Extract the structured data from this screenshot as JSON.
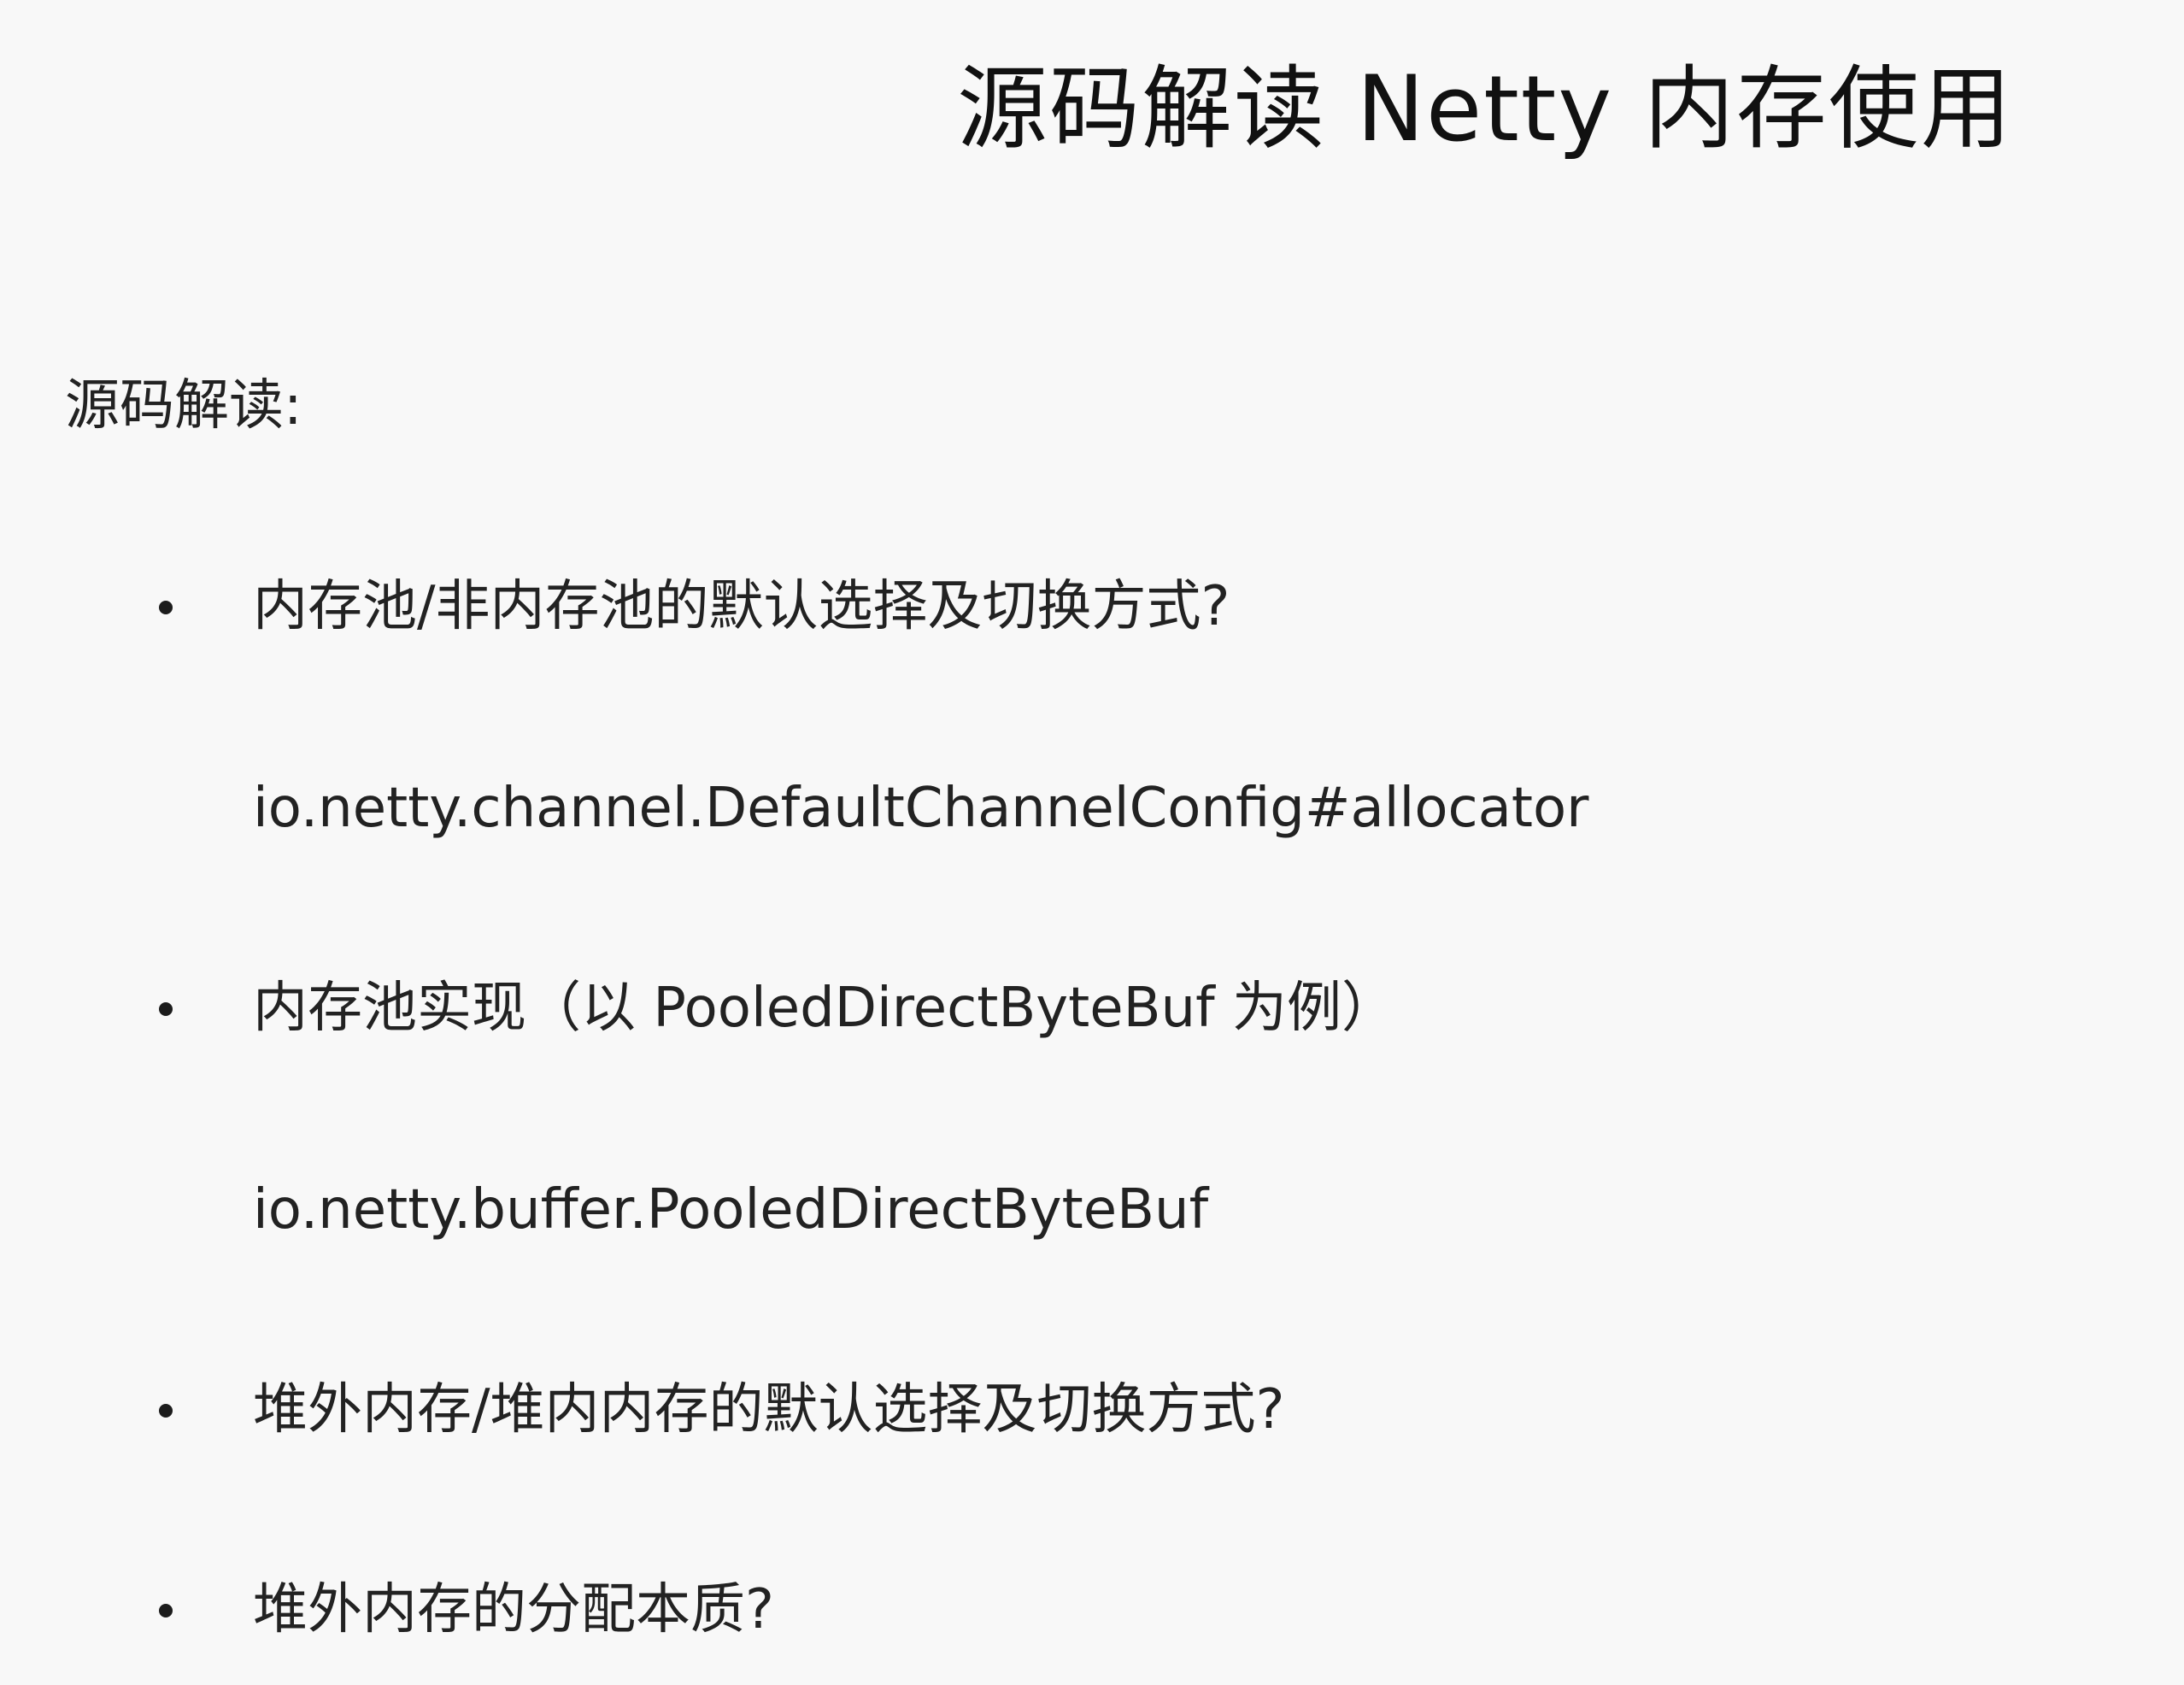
{
  "slide": {
    "title": "源码解读 Netty 内存使用",
    "section_heading": "源码解读:",
    "items": [
      {
        "bullet": "内存池/非内存池的默认选择及切换方式?",
        "code": "io.netty.channel.DefaultChannelConfig#allocator"
      },
      {
        "bullet": "内存池实现（以 PooledDirectByteBuf 为例）",
        "code": "io.netty.buffer.PooledDirectByteBuf"
      },
      {
        "bullet": "堆外内存/堆内内存的默认选择及切换方式?"
      },
      {
        "bullet": "堆外内存的分配本质?"
      }
    ]
  }
}
